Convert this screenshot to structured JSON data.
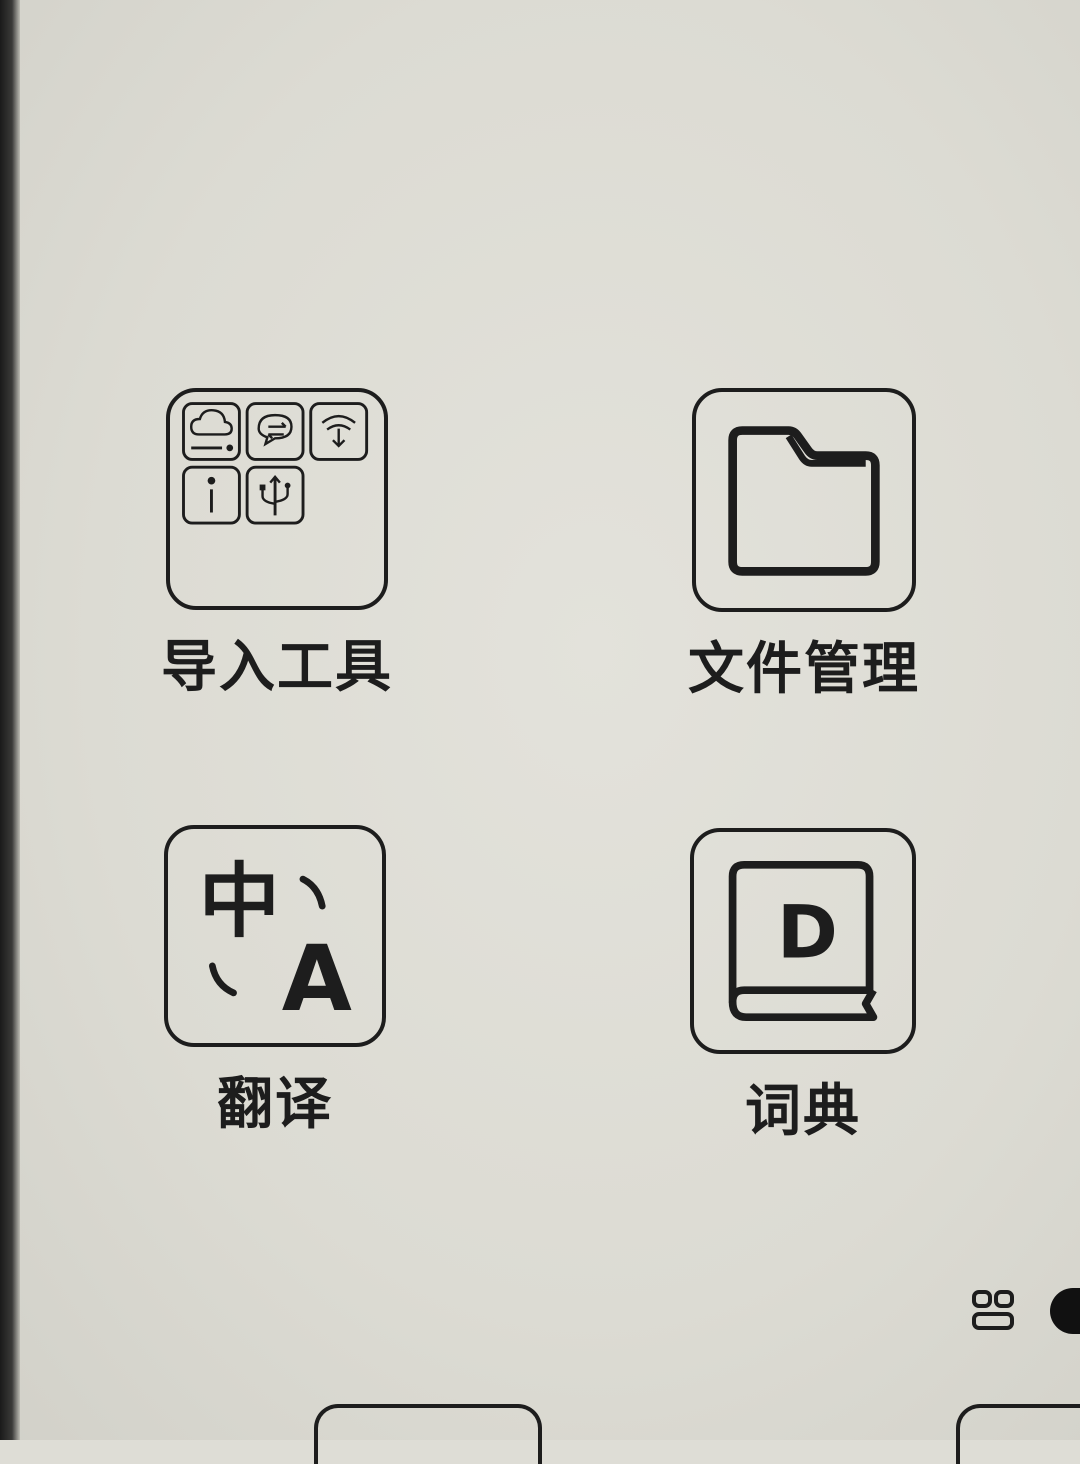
{
  "screen": {
    "background_color": "#deddd6",
    "foreground_color": "#1d1d1d"
  },
  "apps": [
    {
      "id": "import-tools",
      "label": "导入工具",
      "icon": "import-tools-icon"
    },
    {
      "id": "file-manager",
      "label": "文件管理",
      "icon": "folder-icon"
    },
    {
      "id": "translate",
      "label": "翻译",
      "icon": "translate-icon"
    },
    {
      "id": "dictionary",
      "label": "词典",
      "icon": "dictionary-book-icon"
    }
  ],
  "icon_text": {
    "translate_source": "中",
    "translate_target": "A",
    "dictionary_letter": "D"
  },
  "pager": {
    "grid_icon": "app-grid-icon",
    "indicator": "page-indicator-dot"
  }
}
